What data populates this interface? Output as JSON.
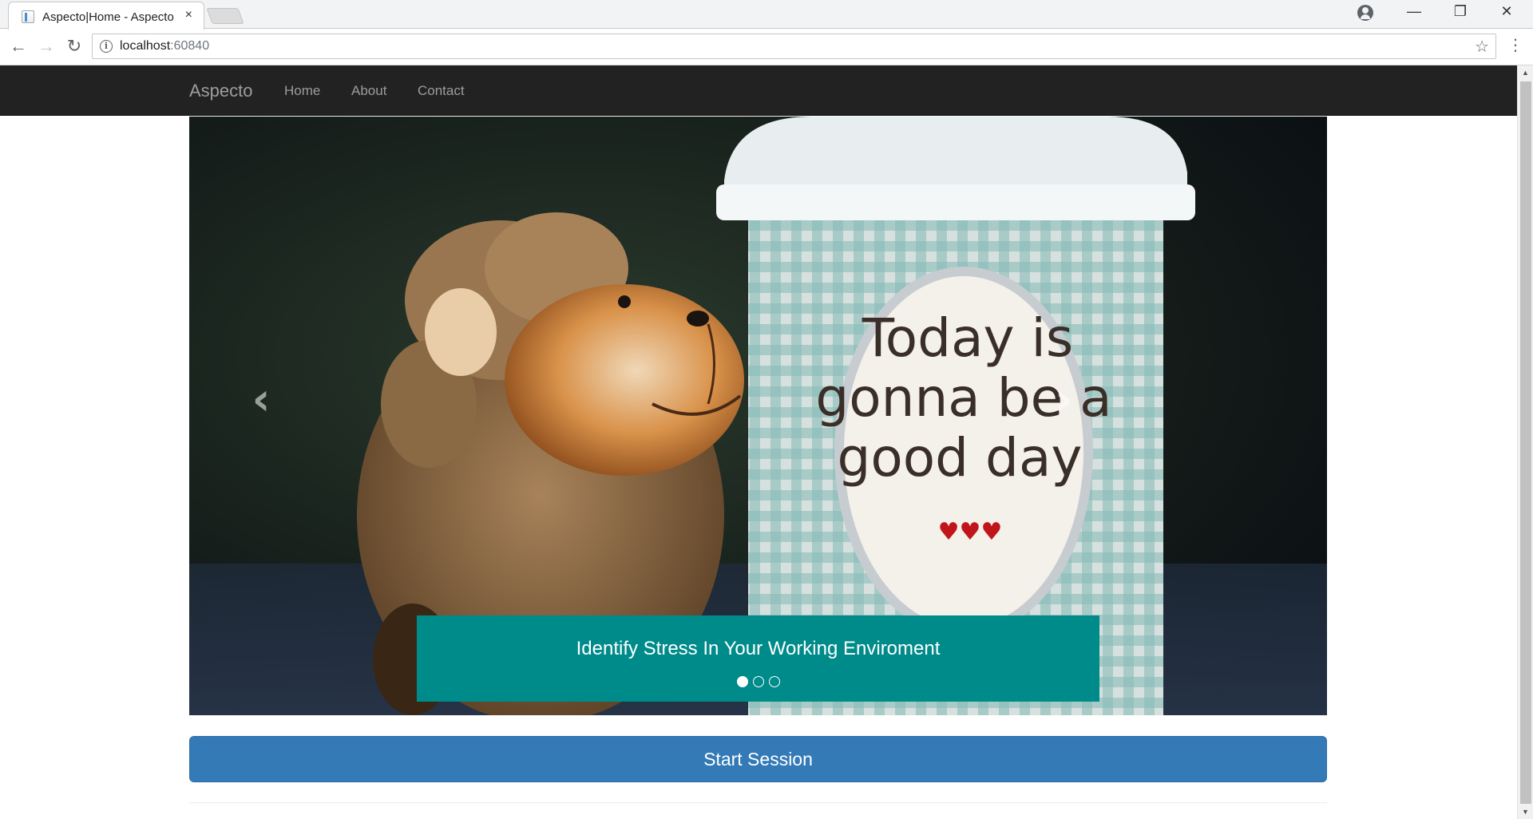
{
  "browser": {
    "tab_title": "Aspecto|Home - Aspecto",
    "tab_close": "×",
    "url_host": "localhost",
    "url_port": ":60840",
    "window_controls": {
      "minimize": "—",
      "restore": "❐",
      "close": "✕"
    },
    "nav": {
      "back": "←",
      "forward": "→",
      "reload": "↻"
    },
    "info_glyph": "i",
    "star_glyph": "☆",
    "menu_glyph": "⋮"
  },
  "navbar": {
    "brand": "Aspecto",
    "links": [
      {
        "label": "Home"
      },
      {
        "label": "About"
      },
      {
        "label": "Contact"
      }
    ]
  },
  "carousel": {
    "caption": "Identify Stress In Your Working Enviroment",
    "slide_count": 3,
    "active_slide": 1,
    "prev_glyph": "‹",
    "next_glyph": "›",
    "cup_text": [
      "Today is",
      "gonna be a",
      "good day"
    ],
    "hearts": "♥♥♥",
    "caption_color": "#008b8b"
  },
  "actions": {
    "start_session": "Start Session",
    "button_color": "#337ab7"
  },
  "icons": [
    "info-icon",
    "star-icon",
    "back-arrow-icon",
    "forward-arrow-icon",
    "reload-icon",
    "profile-icon",
    "chevron-left-icon",
    "chevron-right-icon"
  ]
}
